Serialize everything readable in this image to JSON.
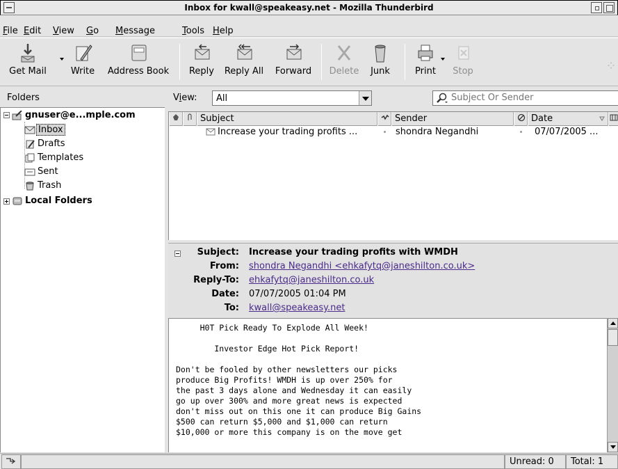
{
  "window": {
    "title": "Inbox for kwall@speakeasy.net - Mozilla Thunderbird"
  },
  "menubar": {
    "items": [
      {
        "label": "File"
      },
      {
        "label": "Edit"
      },
      {
        "label": "View"
      },
      {
        "label": "Go"
      },
      {
        "label": "Message"
      },
      {
        "label": "Tools"
      },
      {
        "label": "Help"
      }
    ]
  },
  "toolbar": {
    "get_mail": "Get Mail",
    "write": "Write",
    "address_book": "Address Book",
    "reply": "Reply",
    "reply_all": "Reply All",
    "forward": "Forward",
    "delete": "Delete",
    "junk": "Junk",
    "print": "Print",
    "stop": "Stop"
  },
  "folders": {
    "pane_label": "Folders",
    "account": "gnuser@e...mple.com",
    "items": [
      {
        "label": "Inbox",
        "icon": "inbox-icon"
      },
      {
        "label": "Drafts",
        "icon": "drafts-icon"
      },
      {
        "label": "Templates",
        "icon": "templates-icon"
      },
      {
        "label": "Sent",
        "icon": "sent-icon"
      },
      {
        "label": "Trash",
        "icon": "trash-icon"
      }
    ],
    "local_folders": "Local Folders"
  },
  "viewbar": {
    "view_label_prefix": "V",
    "view_label_underlined": "i",
    "view_label_suffix": "ew:",
    "view_value": "All",
    "search_placeholder": "Subject Or Sender"
  },
  "message_list": {
    "columns": {
      "subject": "Subject",
      "sender": "Sender",
      "date": "Date"
    },
    "rows": [
      {
        "subject": "Increase your trading profits ...",
        "sender": "shondra Negandhi",
        "date": "07/07/2005 ..."
      }
    ]
  },
  "message_header": {
    "subject_key": "Subject:",
    "subject_val": "Increase your trading profits with WMDH",
    "from_key": "From:",
    "from_val": "shondra Negandhi <ehkafytq@janeshilton.co.uk>",
    "replyto_key": "Reply-To:",
    "replyto_val": "ehkafytq@janeshilton.co.uk",
    "date_key": "Date:",
    "date_val": "07/07/2005 01:04 PM",
    "to_key": "To:",
    "to_val": "kwall@speakeasy.net"
  },
  "message_body": {
    "text": "     H0T Pick Ready To Explode All Week!\n\n        Investor Edge Hot Pick Report!\n\nDon't be fooled by other newsletters our picks\nproduce Big Profits! WMDH is up over 250% for\nthe past 3 days alone and Wednesday it can easily\ngo up over 300% and more great news is expected\ndon't miss out on this one it can produce Big Gains\n$500 can return $5,000 and $1,000 can return\n$10,000 or more this company is on the move get"
  },
  "statusbar": {
    "unread": "Unread: 0",
    "total": "Total: 1"
  }
}
